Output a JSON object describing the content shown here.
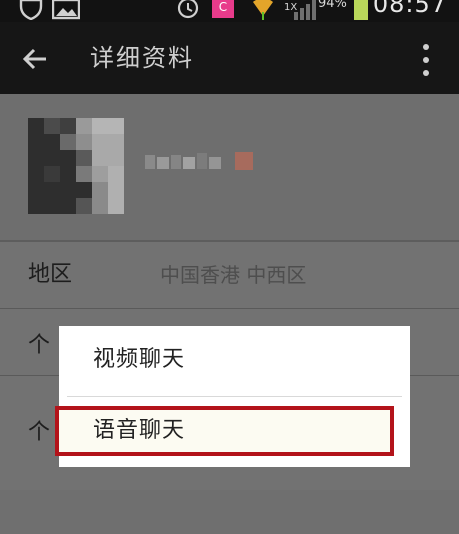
{
  "status_bar": {
    "battery_percent": "94%",
    "time": "08:57",
    "app_badge": "C",
    "network_rate": "1X"
  },
  "toolbar": {
    "title": "详细资料"
  },
  "profile_rows": [
    {
      "label": "地区",
      "value": "中国香港 中西区"
    },
    {
      "label": "个",
      "value": ""
    },
    {
      "label": "个",
      "value": ""
    }
  ],
  "dialog": {
    "options": [
      "视频聊天",
      "语音聊天"
    ]
  },
  "colors": {
    "highlight_border": "#b3131a",
    "app_badge": "#e83b8b",
    "battery": "#b9d85a",
    "wifi": "#e3a52a"
  }
}
